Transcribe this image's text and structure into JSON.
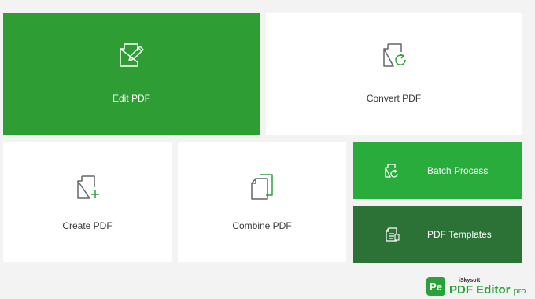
{
  "tiles": {
    "edit": {
      "label": "Edit PDF",
      "icon": "edit-document-icon",
      "color": "#2e9e34"
    },
    "convert": {
      "label": "Convert PDF",
      "icon": "convert-document-icon"
    },
    "create": {
      "label": "Create PDF",
      "icon": "create-document-icon"
    },
    "combine": {
      "label": "Combine PDF",
      "icon": "combine-documents-icon"
    },
    "batch": {
      "label": "Batch Process",
      "icon": "batch-process-icon",
      "color": "#2aac3c"
    },
    "templates": {
      "label": "PDF Templates",
      "icon": "template-icon",
      "color": "#2c7237"
    }
  },
  "brand": {
    "badge": "Pe",
    "maker": "iSkysoft",
    "product": "PDF Editor",
    "edition": "pro",
    "color": "#2aa13a"
  }
}
